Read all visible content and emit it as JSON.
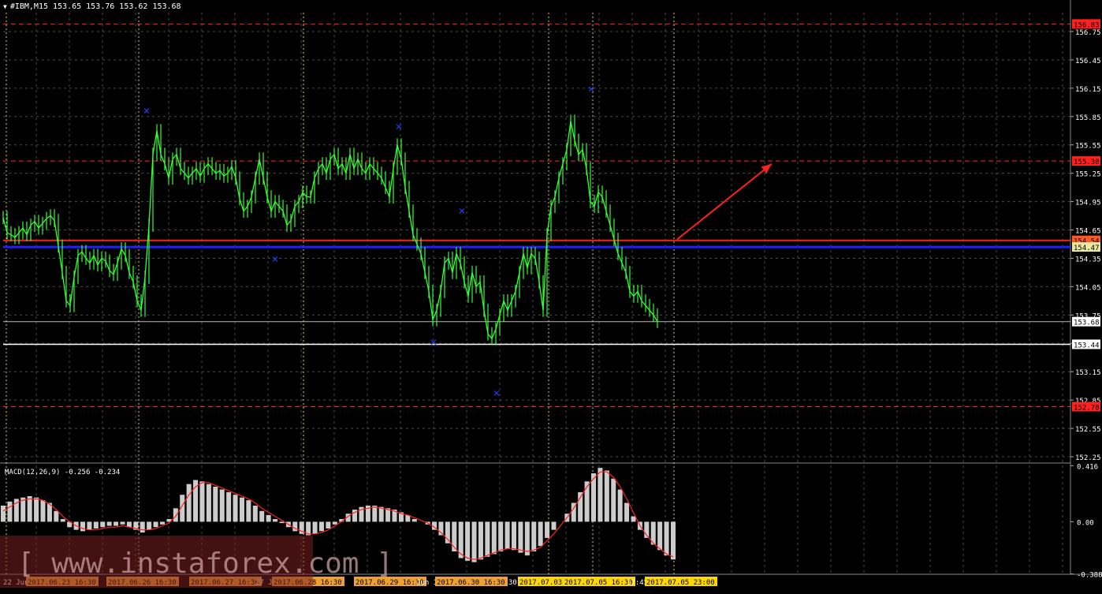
{
  "header": {
    "symbol_line": "#IBM,M15  153.65 153.76 153.62 153.68"
  },
  "macd": {
    "label": "MACD(12,26,9) -0.256 -0.234"
  },
  "watermark": "[ www.instaforex.com ]",
  "colors": {
    "background": "#000000",
    "grid": "#4a4a4a",
    "candles": "#33ff33",
    "signal": "#ff2020",
    "resistance": "#ff2020",
    "support_blue": "#2020ff",
    "white_line": "#ffffff",
    "marker": "#2040ff",
    "histogram": "#cccccc"
  },
  "chart_data": [
    {
      "type": "line",
      "name": "IBM M15 price",
      "ylim": [
        152.2,
        156.95
      ],
      "yticks": [
        "156.75",
        "156.45",
        "156.15",
        "155.85",
        "155.55",
        "155.25",
        "154.95",
        "154.65",
        "154.35",
        "154.05",
        "153.75",
        "153.45",
        "153.15",
        "152.85",
        "152.55",
        "152.25"
      ],
      "price_labels": [
        {
          "value": 156.83,
          "text": "156.83",
          "style": "red-dashed"
        },
        {
          "value": 155.38,
          "text": "155.38",
          "style": "red-dashed"
        },
        {
          "value": 154.54,
          "text": "154.54",
          "style": "red-solid"
        },
        {
          "value": 154.47,
          "text": "154.47",
          "style": "blue-solid"
        },
        {
          "value": 153.68,
          "text": "153.68",
          "style": "current"
        },
        {
          "value": 153.44,
          "text": "153.44",
          "style": "white-solid"
        },
        {
          "value": 152.78,
          "text": "152.78",
          "style": "red-dashed"
        }
      ],
      "x": [
        0,
        5,
        10,
        15,
        20,
        25,
        30,
        35,
        40,
        45,
        50,
        55,
        60,
        65,
        70,
        75,
        80,
        85,
        90,
        95,
        100,
        105,
        110,
        115,
        120,
        125,
        130,
        135,
        140,
        145,
        150,
        155,
        160,
        165,
        170,
        175,
        180,
        185,
        190,
        195,
        200,
        205,
        210,
        215,
        220,
        225,
        230,
        235,
        240,
        245,
        250,
        255,
        260,
        265,
        270,
        275,
        280,
        285,
        290,
        295,
        300,
        305,
        310,
        315,
        320,
        325,
        330,
        335,
        340,
        345,
        350,
        355,
        360,
        365,
        370,
        375,
        380,
        385,
        390,
        395,
        400,
        405,
        410,
        415,
        420,
        425,
        430,
        435,
        440,
        445,
        450,
        455,
        460,
        465,
        470,
        475,
        480,
        485,
        490,
        495,
        500,
        505,
        510,
        515,
        520,
        525,
        530,
        535,
        540,
        545,
        550,
        555,
        560,
        565,
        570,
        575,
        580,
        585,
        590,
        595,
        600,
        605,
        610,
        615,
        620,
        625,
        630,
        635,
        640,
        645,
        650,
        655,
        660,
        665,
        670,
        675,
        680,
        685,
        690,
        695,
        700,
        705,
        710,
        715,
        720,
        725,
        730,
        735,
        740,
        745,
        750,
        755,
        760,
        765,
        770,
        775,
        780,
        785,
        790,
        795,
        800,
        805,
        810,
        815,
        820,
        825,
        830,
        835,
        840,
        845,
        850
      ],
      "close": [
        154.78,
        154.62,
        154.6,
        154.57,
        154.62,
        154.67,
        154.6,
        154.7,
        154.74,
        154.67,
        154.72,
        154.77,
        154.8,
        154.75,
        154.48,
        154.2,
        153.9,
        153.85,
        154.15,
        154.38,
        154.42,
        154.35,
        154.3,
        154.38,
        154.28,
        154.35,
        154.32,
        154.22,
        154.18,
        154.3,
        154.45,
        154.38,
        154.2,
        154.1,
        153.9,
        153.8,
        154.15,
        154.7,
        155.45,
        155.7,
        155.45,
        155.35,
        155.2,
        155.4,
        155.45,
        155.3,
        155.25,
        155.2,
        155.25,
        155.3,
        155.22,
        155.3,
        155.35,
        155.3,
        155.25,
        155.28,
        155.22,
        155.25,
        155.32,
        155.2,
        154.98,
        154.85,
        154.9,
        155.0,
        155.2,
        155.4,
        155.2,
        155.0,
        154.85,
        154.95,
        154.9,
        154.85,
        154.7,
        154.75,
        154.9,
        154.95,
        155.05,
        155.0,
        155.0,
        155.2,
        155.3,
        155.35,
        155.25,
        155.4,
        155.45,
        155.3,
        155.35,
        155.25,
        155.45,
        155.3,
        155.4,
        155.3,
        155.25,
        155.35,
        155.3,
        155.25,
        155.2,
        155.1,
        155.0,
        155.3,
        155.55,
        155.4,
        155.1,
        154.85,
        154.6,
        154.5,
        154.4,
        154.2,
        154.0,
        153.7,
        153.8,
        154.0,
        154.3,
        154.35,
        154.2,
        154.4,
        154.3,
        154.1,
        153.95,
        154.2,
        154.05,
        154.1,
        153.8,
        153.55,
        153.5,
        153.6,
        153.75,
        153.9,
        153.8,
        153.9,
        154.0,
        154.2,
        154.4,
        154.25,
        154.4,
        154.35,
        154.1,
        153.8,
        154.6,
        154.9,
        155.0,
        155.2,
        155.35,
        155.5,
        155.8,
        155.6,
        155.45,
        155.5,
        155.3,
        154.95,
        154.9,
        155.05,
        155.0,
        154.85,
        154.7,
        154.55,
        154.4,
        154.3,
        154.2,
        154.0,
        153.95,
        154.0,
        153.9,
        153.85,
        153.8,
        153.75,
        153.68
      ],
      "high_markers": [
        {
          "x": 182,
          "y": 155.92
        },
        {
          "x": 502,
          "y": 155.75
        },
        {
          "x": 582,
          "y": 154.86
        },
        {
          "x": 746,
          "y": 156.15
        }
      ],
      "low_markers": [
        {
          "x": 345,
          "y": 154.35
        },
        {
          "x": 546,
          "y": 153.47
        },
        {
          "x": 626,
          "y": 152.93
        }
      ],
      "arrow": {
        "x1": 855,
        "y1": 154.55,
        "x2": 975,
        "y2": 155.35
      },
      "x_labels": [
        "22 Jun",
        "2017.06.23 16:30",
        "2017.06.26 16:30",
        "2017.06.27 16:30",
        "27 J",
        "2017.06.28 16:30",
        "2017.06.29 16:30",
        "Jun 1",
        "2017.06.30 16:30",
        "30",
        "2017.07.03",
        "2017.07.05 16:30",
        "17:45",
        "2017.07.05 23:00"
      ],
      "grid": true
    },
    {
      "type": "bar",
      "name": "MACD(12,26,9)",
      "ylim": [
        -0.39,
        0.43
      ],
      "yticks": [
        "0.416",
        "0.00",
        "-0.388"
      ],
      "histogram": [
        0.12,
        0.15,
        0.17,
        0.18,
        0.19,
        0.18,
        0.16,
        0.14,
        0.08,
        0.02,
        -0.04,
        -0.06,
        -0.07,
        -0.06,
        -0.05,
        -0.04,
        -0.03,
        -0.03,
        -0.02,
        -0.04,
        -0.06,
        -0.08,
        -0.06,
        -0.04,
        -0.02,
        0.02,
        0.1,
        0.2,
        0.28,
        0.31,
        0.3,
        0.28,
        0.26,
        0.24,
        0.22,
        0.2,
        0.18,
        0.16,
        0.12,
        0.08,
        0.05,
        0.02,
        -0.01,
        -0.04,
        -0.07,
        -0.09,
        -0.1,
        -0.09,
        -0.07,
        -0.05,
        -0.02,
        0.02,
        0.06,
        0.09,
        0.11,
        0.12,
        0.12,
        0.11,
        0.1,
        0.09,
        0.07,
        0.05,
        0.02,
        0.0,
        -0.02,
        -0.06,
        -0.1,
        -0.16,
        -0.22,
        -0.27,
        -0.29,
        -0.3,
        -0.28,
        -0.26,
        -0.24,
        -0.22,
        -0.2,
        -0.21,
        -0.23,
        -0.25,
        -0.22,
        -0.18,
        -0.12,
        -0.06,
        0.0,
        0.06,
        0.14,
        0.22,
        0.3,
        0.36,
        0.4,
        0.38,
        0.32,
        0.24,
        0.14,
        0.04,
        -0.06,
        -0.12,
        -0.17,
        -0.21,
        -0.25,
        -0.28
      ],
      "signal": [
        0.08,
        0.11,
        0.14,
        0.16,
        0.17,
        0.17,
        0.16,
        0.13,
        0.09,
        0.04,
        0.0,
        -0.03,
        -0.05,
        -0.06,
        -0.06,
        -0.05,
        -0.04,
        -0.04,
        -0.03,
        -0.04,
        -0.05,
        -0.06,
        -0.06,
        -0.05,
        -0.03,
        -0.01,
        0.04,
        0.12,
        0.2,
        0.26,
        0.29,
        0.29,
        0.27,
        0.25,
        0.23,
        0.21,
        0.19,
        0.17,
        0.14,
        0.1,
        0.07,
        0.04,
        0.01,
        -0.02,
        -0.05,
        -0.07,
        -0.09,
        -0.09,
        -0.08,
        -0.06,
        -0.03,
        0.0,
        0.04,
        0.07,
        0.09,
        0.1,
        0.11,
        0.1,
        0.09,
        0.08,
        0.06,
        0.05,
        0.03,
        0.01,
        -0.01,
        -0.04,
        -0.08,
        -0.13,
        -0.19,
        -0.24,
        -0.27,
        -0.28,
        -0.27,
        -0.25,
        -0.23,
        -0.21,
        -0.2,
        -0.2,
        -0.21,
        -0.22,
        -0.21,
        -0.19,
        -0.14,
        -0.09,
        -0.03,
        0.03,
        0.1,
        0.18,
        0.26,
        0.32,
        0.37,
        0.37,
        0.33,
        0.26,
        0.17,
        0.07,
        -0.03,
        -0.1,
        -0.16,
        -0.2,
        -0.24,
        -0.26
      ]
    }
  ]
}
